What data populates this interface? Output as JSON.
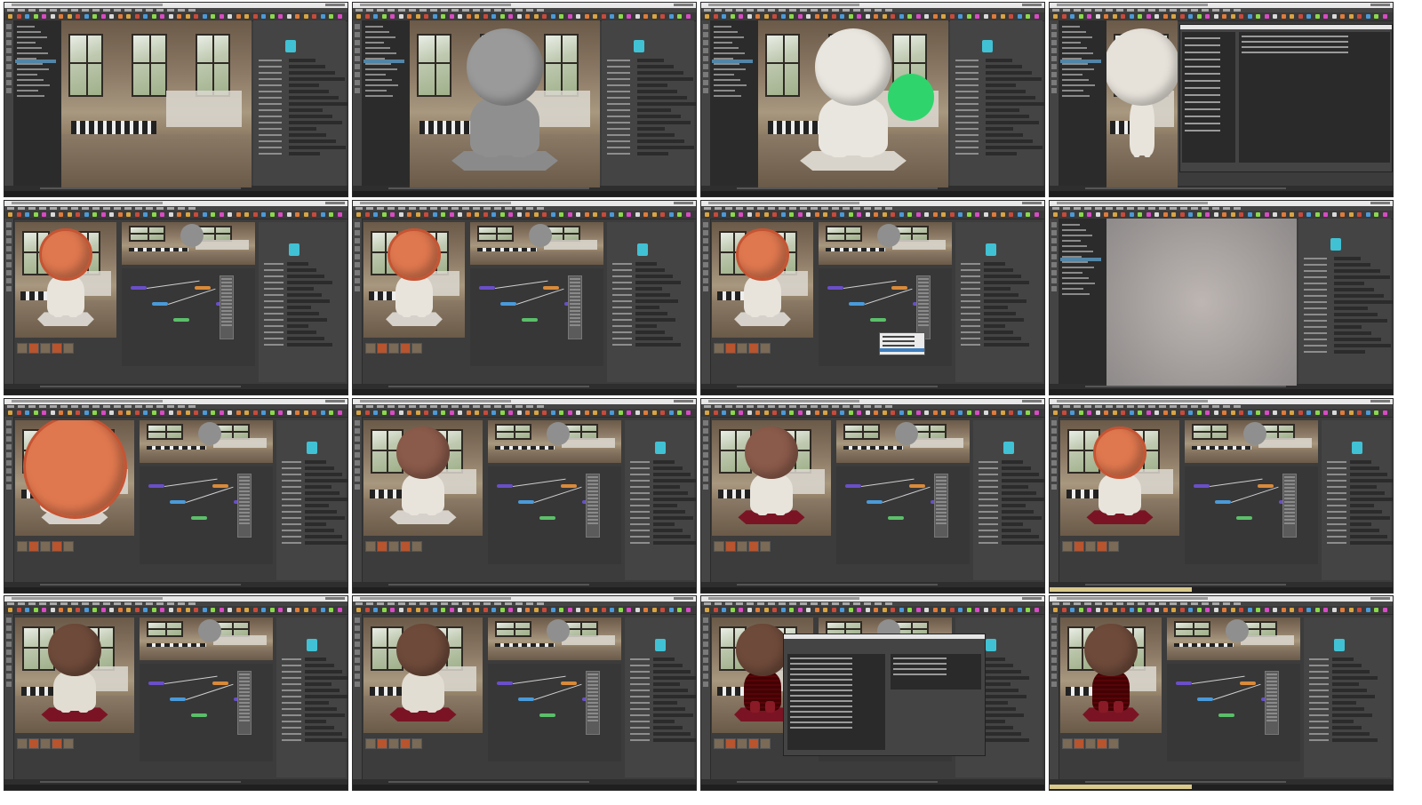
{
  "contact_sheet": {
    "rows": 4,
    "columns": 4,
    "tiles": [
      {
        "id": "t01",
        "scene": "hdri-setup",
        "viewport": "industrial-room",
        "character": "none"
      },
      {
        "id": "t02",
        "scene": "base-mesh",
        "viewport": "industrial-room",
        "character": "grey-clay"
      },
      {
        "id": "t03",
        "scene": "xgen-preview",
        "viewport": "industrial-room",
        "character": "white-fluffy-green-helmet"
      },
      {
        "id": "t04",
        "scene": "file-browser",
        "viewport": "industrial-room",
        "character": "white"
      },
      {
        "id": "t05",
        "scene": "hypershade-helmet",
        "viewport": "industrial-room",
        "character": "orange-helmet"
      },
      {
        "id": "t06",
        "scene": "hypershade-helmet",
        "viewport": "industrial-room",
        "character": "orange-helmet"
      },
      {
        "id": "t07",
        "scene": "hypershade-menu",
        "viewport": "industrial-room",
        "character": "orange-helmet"
      },
      {
        "id": "t08",
        "scene": "noise-render",
        "viewport": "noise",
        "character": "none"
      },
      {
        "id": "t09",
        "scene": "hypershade-closeup",
        "viewport": "industrial-room",
        "character": "orange-helmet-closeup"
      },
      {
        "id": "t10",
        "scene": "hypershade-body",
        "viewport": "industrial-room",
        "character": "white-body"
      },
      {
        "id": "t11",
        "scene": "hypershade-body",
        "viewport": "industrial-room",
        "character": "white-red-base"
      },
      {
        "id": "t12",
        "scene": "hypershade-body",
        "viewport": "industrial-room",
        "character": "orange-helmet-red-base"
      },
      {
        "id": "t13",
        "scene": "fabric-body",
        "viewport": "industrial-room",
        "character": "white-fabric"
      },
      {
        "id": "t14",
        "scene": "fabric-body",
        "viewport": "industrial-room",
        "character": "white-fabric"
      },
      {
        "id": "t15",
        "scene": "file-dialog",
        "viewport": "industrial-room",
        "character": "red-plaid"
      },
      {
        "id": "t16",
        "scene": "final-plaid",
        "viewport": "industrial-room",
        "character": "red-plaid"
      }
    ]
  },
  "colors": {
    "maya_bg": "#3c3c3c",
    "panel": "#444444",
    "selection": "#5285a6",
    "accent": "#41c1d4",
    "node_purple": "#6a4fc8",
    "helmet_orange": "#e0784f",
    "plaid_red": "#8a1a26",
    "base_red": "#7a1424"
  }
}
